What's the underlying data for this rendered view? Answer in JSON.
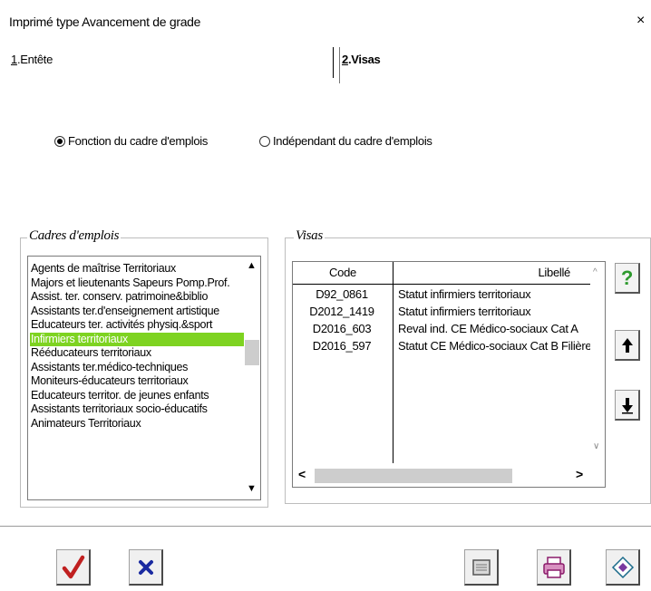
{
  "window": {
    "title": "Imprimé type Avancement de grade",
    "close_glyph": "×"
  },
  "tabs": [
    {
      "num": "1",
      "label": ".Entête"
    },
    {
      "num": "2",
      "label": ".Visas"
    }
  ],
  "options": {
    "fonction": "Fonction du cadre d'emplois",
    "independant": "Indépendant du cadre d'emplois",
    "selected": "fonction"
  },
  "cadres": {
    "label": "Cadres d'emplois",
    "items": [
      "Agents de maîtrise Territoriaux",
      "Majors et lieutenants Sapeurs Pomp.Prof.",
      "Assist. ter. conserv. patrimoine&biblio",
      "Assistants ter.d'enseignement artistique",
      "Educateurs ter. activités physiq.&sport",
      "Infirmiers territoriaux",
      "Rééducateurs territoriaux",
      "Assistants ter.médico-techniques",
      "Moniteurs-éducateurs territoriaux",
      "Educateurs territor. de jeunes enfants",
      "Assistants territoriaux socio-éducatifs",
      "Animateurs Territoriaux"
    ],
    "selected_index": 5
  },
  "visas": {
    "label": "Visas",
    "columns": [
      "Code",
      "Libellé"
    ],
    "rows": [
      {
        "code": "D92_0861",
        "libelle": "Statut infirmiers territoriaux"
      },
      {
        "code": "D2012_1419",
        "libelle": "Statut infirmiers territoriaux"
      },
      {
        "code": "D2016_603",
        "libelle": "Reval ind. CE Médico-sociaux Cat A"
      },
      {
        "code": "D2016_597",
        "libelle": "Statut CE Médico-sociaux Cat B Filière"
      }
    ]
  },
  "side_buttons": {
    "help": "?",
    "up_icon": "arrow-up-icon",
    "down_icon": "arrow-down-icon"
  },
  "colors": {
    "selection": "#7ed321",
    "validate": "#c02020",
    "cancel": "#1a2aa0",
    "help": "#2e9a2e"
  }
}
